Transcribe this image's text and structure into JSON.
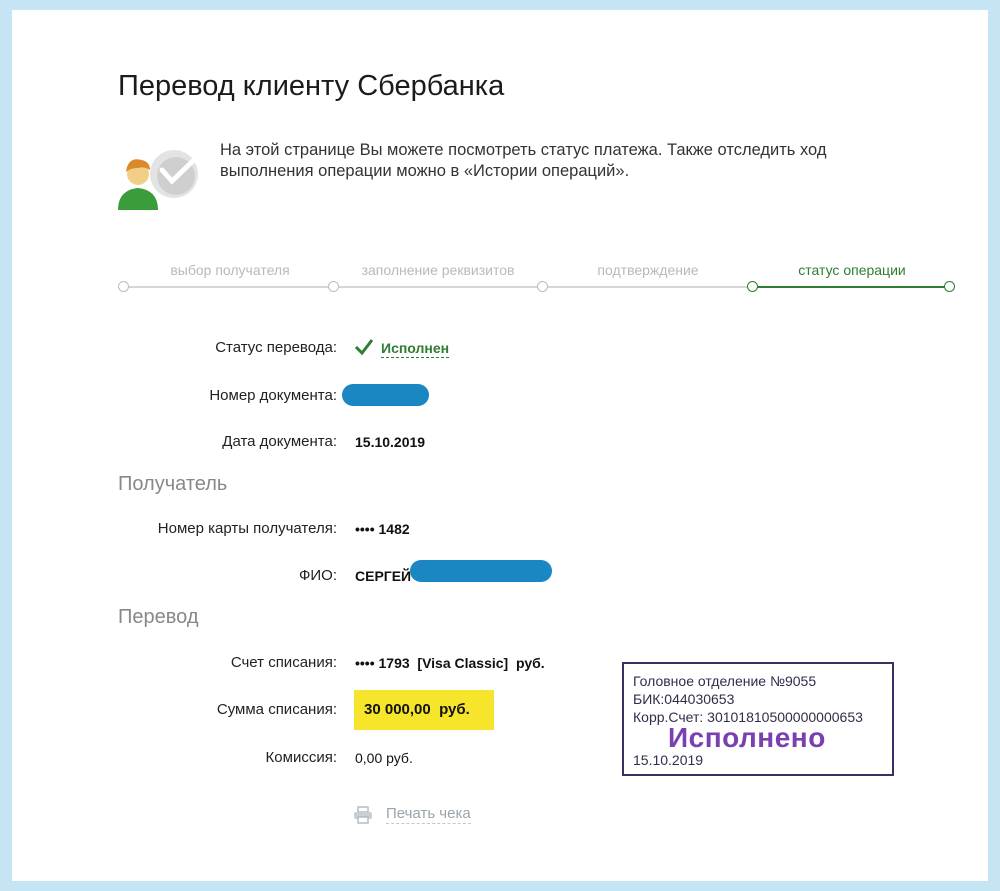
{
  "page": {
    "title": "Перевод клиенту Сбербанка",
    "intro": "На этой странице Вы можете посмотреть статус платежа. Также отследить ход выполнения операции можно в «Истории операций»."
  },
  "steps": [
    {
      "label": "выбор получателя",
      "active": false
    },
    {
      "label": "заполнение реквизитов",
      "active": false
    },
    {
      "label": "подтверждение",
      "active": false
    },
    {
      "label": "статус операции",
      "active": true
    }
  ],
  "status": {
    "label": "Статус перевода:",
    "value": "Исполнен"
  },
  "document": {
    "number_label": "Номер документа:",
    "date_label": "Дата документа:",
    "date_value": "15.10.2019"
  },
  "recipient": {
    "heading": "Получатель",
    "card_label": "Номер карты получателя:",
    "card_value": "•••• 1482",
    "name_label": "ФИО:",
    "name_value": "СЕРГЕЙ"
  },
  "transfer": {
    "heading": "Перевод",
    "account_label": "Счет списания:",
    "account_value": "•••• 1793  [Visa Classic]  руб.",
    "amount_label": "Сумма списания:",
    "amount_value": "30 000,00  руб.",
    "fee_label": "Комиссия:",
    "fee_value": "0,00 руб."
  },
  "actions": {
    "print_label": "Печать чека"
  },
  "stamp": {
    "line1": "Головное отделение №9055",
    "line2": "БИК:044030653",
    "line3": "Корр.Счет: 30101810500000000653",
    "big": "Исполнено",
    "date": "15.10.2019"
  },
  "colors": {
    "accent_green": "#2e7d32",
    "highlight_yellow": "#f7e52c",
    "stamp_purple": "#7a3fb0",
    "frame_blue": "#c5e4f4"
  }
}
